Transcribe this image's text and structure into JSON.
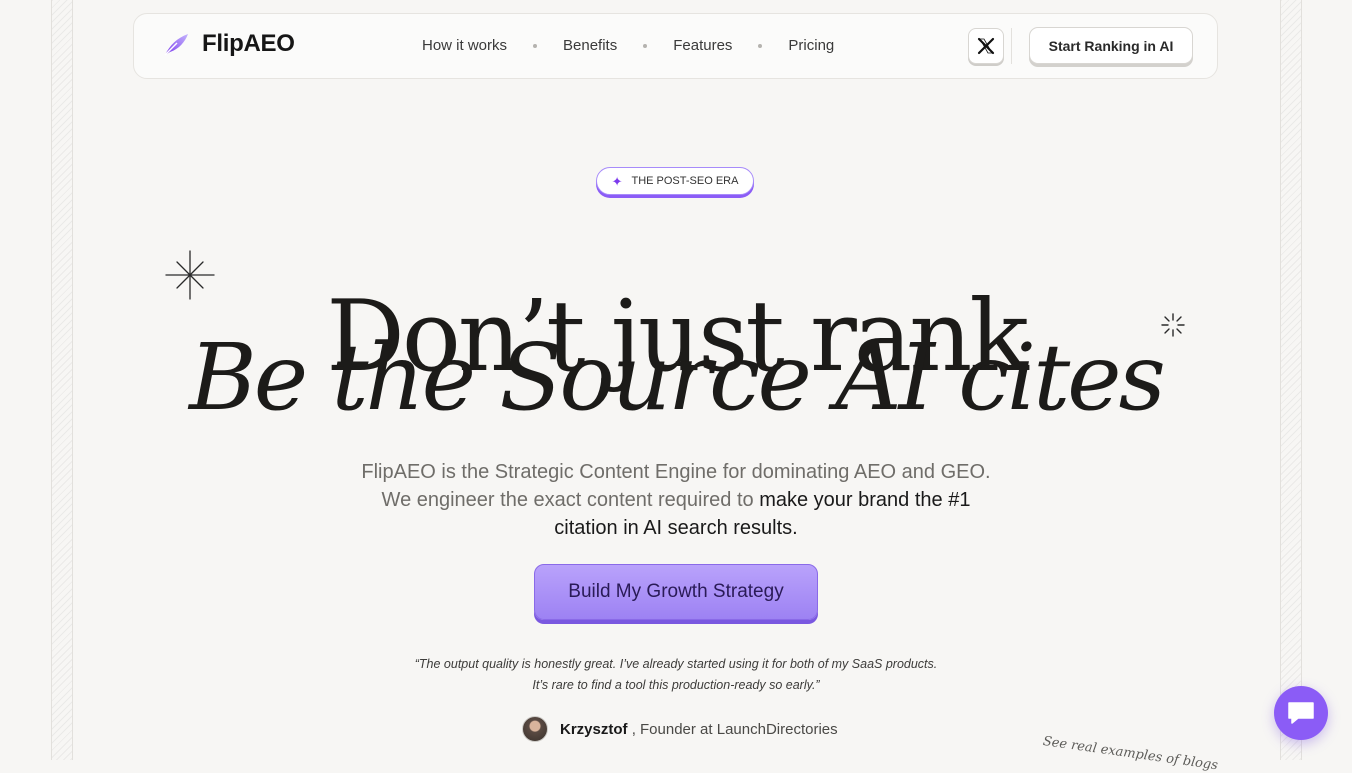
{
  "brand": {
    "name": "FlipAEO"
  },
  "nav": {
    "links": [
      "How it works",
      "Benefits",
      "Features",
      "Pricing"
    ],
    "cta_label": "Start Ranking in AI"
  },
  "hero": {
    "badge": "THE POST-SEO ERA",
    "headline_line1": "Don’t just rank",
    "headline_line2": "Be the Source AI cites",
    "subtitle_line1": "FlipAEO is the Strategic Content Engine for dominating AEO and GEO.",
    "subtitle_line2_muted": "We engineer the exact content required to ",
    "subtitle_line2_emph": "make your brand the #1",
    "subtitle_line3": "citation in AI search results.",
    "cta_label": "Build My Growth Strategy"
  },
  "testimonial": {
    "quote_line1": "“The output quality is honestly great. I’ve already started using it for both of my SaaS products.",
    "quote_line2": "It’s rare to find a tool this production-ready so early.”",
    "author_name": "Krzysztof",
    "author_role": ", Founder at LaunchDirectories"
  },
  "note": {
    "text": "See real examples of blogs"
  },
  "colors": {
    "accent": "#8b5cf6",
    "cta_fill": "#ab93f8",
    "text": "#1c1b19",
    "background": "#f7f6f4"
  },
  "icons": {
    "logo": "feather-logo-icon",
    "x": "x-twitter-icon",
    "badge": "sparkle-icon",
    "chat": "chat-icon"
  }
}
